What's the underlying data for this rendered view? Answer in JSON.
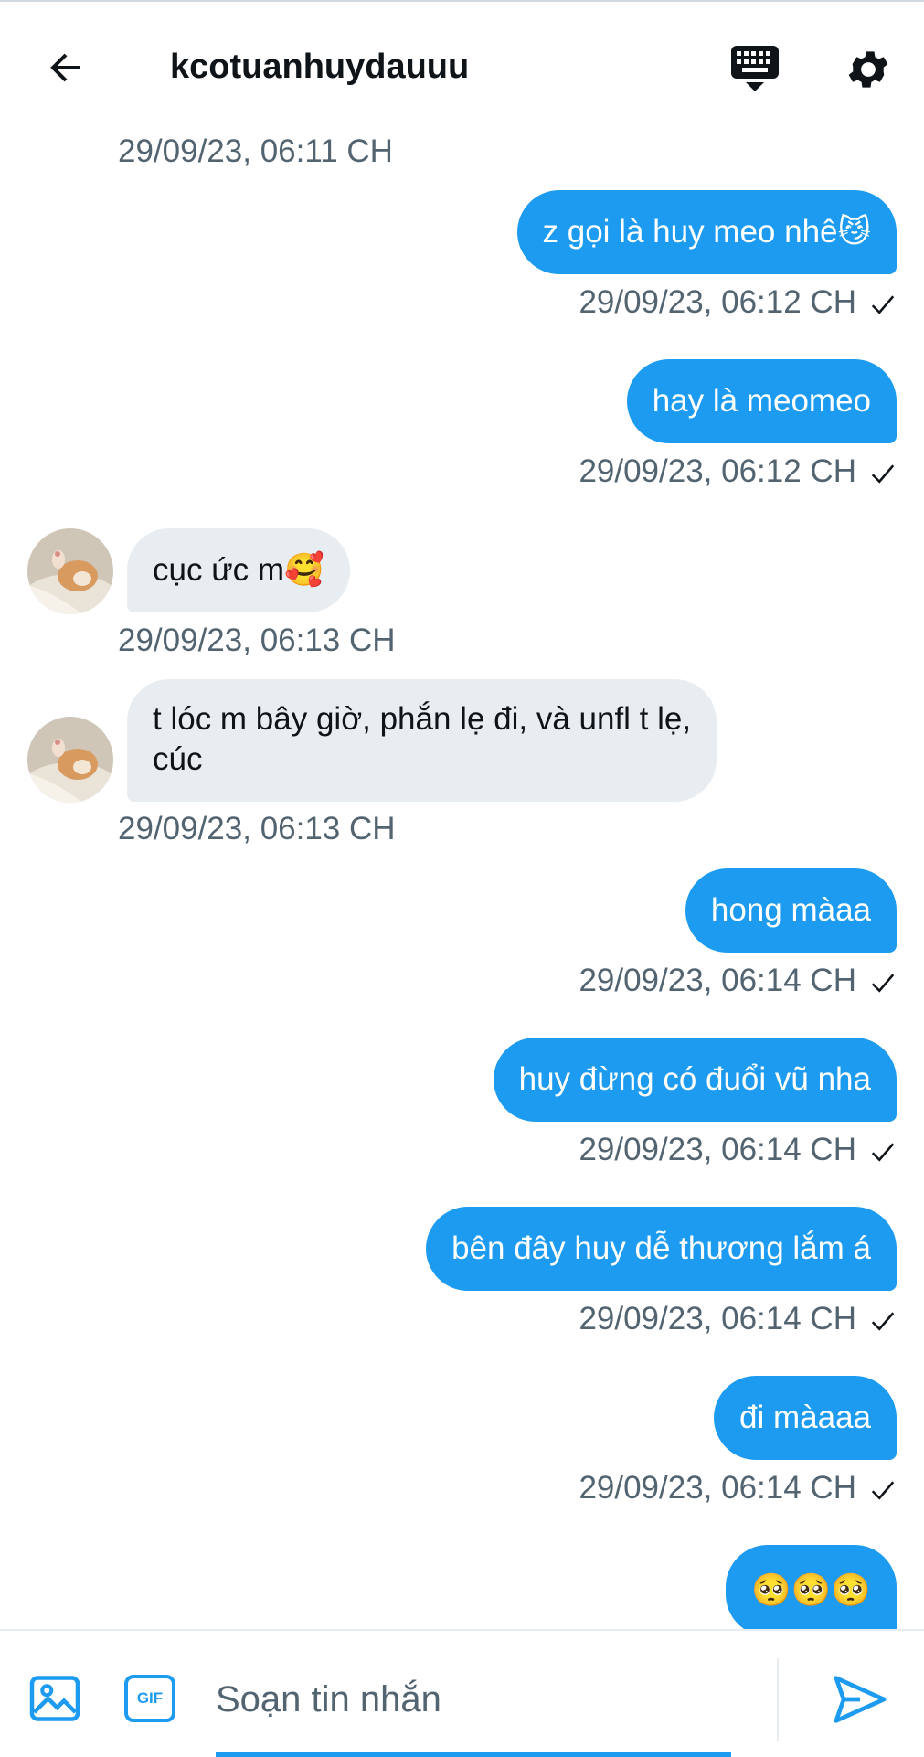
{
  "header": {
    "title": "kcotuanhuydauuu",
    "back_icon": "arrow-left-icon",
    "keyboard_icon": "keyboard-icon",
    "settings_icon": "gear-icon"
  },
  "colors": {
    "accent": "#1d9bf0",
    "incoming_bubble": "#e8edf1",
    "timestamp": "#536471"
  },
  "messages": [
    {
      "direction": "in",
      "timestamp": "29/09/23, 06:11 CH"
    },
    {
      "direction": "out",
      "text": "z gọi là huy meo nhê😼",
      "timestamp": "29/09/23, 06:12 CH",
      "status": "✓"
    },
    {
      "direction": "out",
      "text": "hay là meomeo",
      "timestamp": "29/09/23, 06:12 CH",
      "status": "✓"
    },
    {
      "direction": "in",
      "text": "cục ức m🥰",
      "timestamp": "29/09/23, 06:13 CH"
    },
    {
      "direction": "in",
      "text_line1": "t lóc m bây giờ, phắn lẹ đi, và unfl t lẹ,",
      "text_line2": "cúc",
      "timestamp": "29/09/23, 06:13 CH"
    },
    {
      "direction": "out",
      "text": "hong màaa",
      "timestamp": "29/09/23, 06:14 CH",
      "status": "✓"
    },
    {
      "direction": "out",
      "text": "huy đừng có đuổi vũ nha",
      "timestamp": "29/09/23, 06:14 CH",
      "status": "✓"
    },
    {
      "direction": "out",
      "text": "bên đây huy dễ thương lắm á",
      "timestamp": "29/09/23, 06:14 CH",
      "status": "✓"
    },
    {
      "direction": "out",
      "text": "đi màaaa",
      "timestamp": "29/09/23, 06:14 CH",
      "status": "✓"
    },
    {
      "direction": "out",
      "text": "🥺🥺🥺"
    }
  ],
  "composer": {
    "placeholder": "Soạn tin nhắn",
    "value": "",
    "image_icon": "image-icon",
    "gif_label": "GIF",
    "send_icon": "send-icon"
  }
}
